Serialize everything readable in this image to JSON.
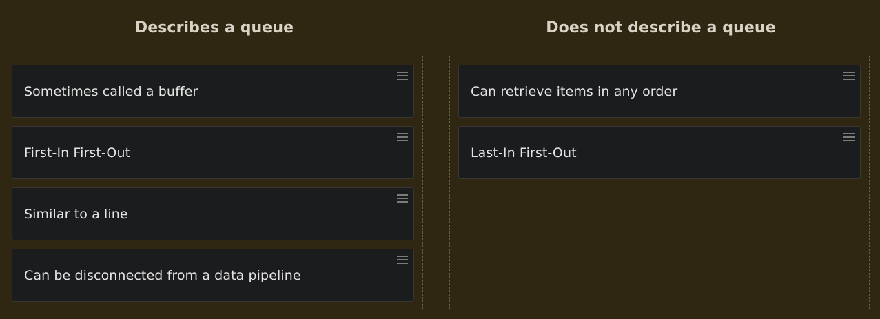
{
  "columns": {
    "left": {
      "title": "Describes a queue",
      "items": [
        "Sometimes called a buffer",
        "First-In First-Out",
        "Similar to a line",
        "Can be disconnected from a data pipeline"
      ]
    },
    "right": {
      "title": "Does not describe a queue",
      "items": [
        "Can retrieve items in any order",
        "Last-In First-Out"
      ]
    }
  },
  "icons": {
    "drag_handle": "drag-handle-icon"
  }
}
